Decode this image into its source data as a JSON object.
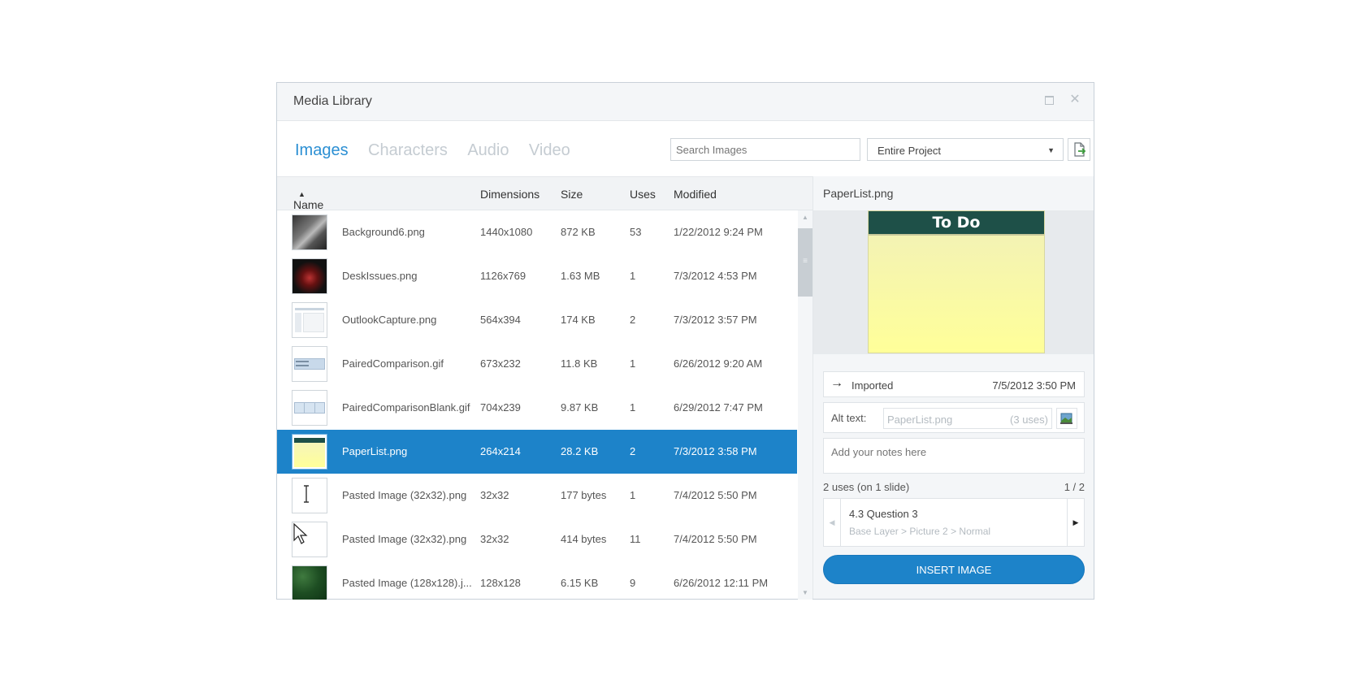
{
  "window": {
    "title": "Media Library"
  },
  "tabs": [
    {
      "label": "Images",
      "active": true
    },
    {
      "label": "Characters",
      "active": false
    },
    {
      "label": "Audio",
      "active": false
    },
    {
      "label": "Video",
      "active": false
    }
  ],
  "search": {
    "placeholder": "Search Images"
  },
  "scope": {
    "selected": "Entire Project"
  },
  "columns": {
    "name": "Name",
    "dimensions": "Dimensions",
    "size": "Size",
    "uses": "Uses",
    "modified": "Modified"
  },
  "rows": [
    {
      "name": "Background6.png",
      "dimensions": "1440x1080",
      "size": "872 KB",
      "uses": "53",
      "modified": "1/22/2012 9:24 PM",
      "thumb": "gray-curve"
    },
    {
      "name": "DeskIssues.png",
      "dimensions": "1126x769",
      "size": "1.63 MB",
      "uses": "1",
      "modified": "7/3/2012 4:53 PM",
      "thumb": "dark-desk"
    },
    {
      "name": "OutlookCapture.png",
      "dimensions": "564x394",
      "size": "174 KB",
      "uses": "2",
      "modified": "7/3/2012 3:57 PM",
      "thumb": "screenshot"
    },
    {
      "name": "PairedComparison.gif",
      "dimensions": "673x232",
      "size": "11.8 KB",
      "uses": "1",
      "modified": "6/26/2012 9:20 AM",
      "thumb": "table"
    },
    {
      "name": "PairedComparisonBlank.gif",
      "dimensions": "704x239",
      "size": "9.87 KB",
      "uses": "1",
      "modified": "6/29/2012 7:47 PM",
      "thumb": "table-blank"
    },
    {
      "name": "PaperList.png",
      "dimensions": "264x214",
      "size": "28.2 KB",
      "uses": "2",
      "modified": "7/3/2012 3:58 PM",
      "thumb": "paper",
      "selected": true
    },
    {
      "name": "Pasted Image (32x32).png",
      "dimensions": "32x32",
      "size": "177 bytes",
      "uses": "1",
      "modified": "7/4/2012 5:50 PM",
      "thumb": "ibeam"
    },
    {
      "name": "Pasted Image (32x32).png",
      "dimensions": "32x32",
      "size": "414 bytes",
      "uses": "11",
      "modified": "7/4/2012 5:50 PM",
      "thumb": "pointer"
    },
    {
      "name": "Pasted Image (128x128).j...",
      "dimensions": "128x128",
      "size": "6.15 KB",
      "uses": "9",
      "modified": "6/26/2012 12:11 PM",
      "thumb": "green"
    }
  ],
  "preview": {
    "filename": "PaperList.png",
    "paper_heading": "To Do"
  },
  "details": {
    "imported_label": "Imported",
    "imported_date": "7/5/2012 3:50 PM",
    "alt_label": "Alt text:",
    "alt_value": "PaperList.png",
    "alt_uses": "(3 uses)",
    "notes_placeholder": "Add your notes here",
    "uses_summary": "2 uses (on 1 slide)",
    "pager": "1 / 2",
    "usage_slide": "4.3 Question 3",
    "usage_path": "Base Layer > Picture 2 > Normal",
    "insert_label": "INSERT IMAGE"
  },
  "colors": {
    "accent": "#1d83c9",
    "tab_active": "#2b8fd3",
    "tab_inactive": "#c5ccd2"
  }
}
